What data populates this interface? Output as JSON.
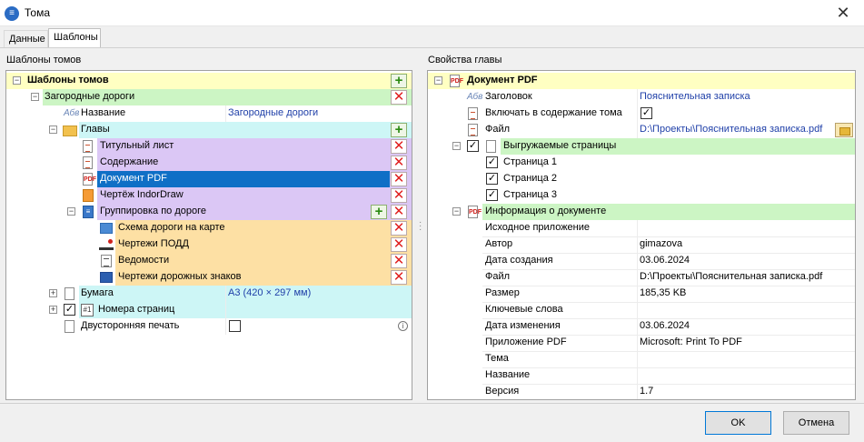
{
  "window": {
    "title": "Тома",
    "close_glyph": "✕"
  },
  "tabs": [
    {
      "label": "Данные",
      "active": false
    },
    {
      "label": "Шаблоны",
      "active": true
    }
  ],
  "left": {
    "section_label": "Шаблоны томов",
    "header": "Шаблоны томов",
    "volume": "Загородные дороги",
    "name_label": "Название",
    "name_value": "Загородные дороги",
    "chapters_label": "Главы",
    "chapters": [
      "Титульный лист",
      "Содержание",
      "Документ PDF",
      "Чертёж IndorDraw",
      "Группировка по дороге"
    ],
    "group_items": [
      "Схема дороги на карте",
      "Чертежи ПОДД",
      "Ведомости",
      "Чертежи дорожных знаков"
    ],
    "paper_label": "Бумага",
    "paper_value": "А3 (420 × 297 мм)",
    "page_numbers_label": "Номера страниц",
    "duplex_label": "Двусторонняя печать"
  },
  "right": {
    "section_label": "Свойства главы",
    "header": "Документ PDF",
    "heading_label": "Заголовок",
    "heading_value": "Пояснительная записка",
    "include_label": "Включать в содержание тома",
    "file_label": "Файл",
    "file_value": "D:\\Проекты\\Пояснительная записка.pdf",
    "pages_label": "Выгружаемые страницы",
    "pages": [
      "Страница 1",
      "Страница 2",
      "Страница 3"
    ],
    "docinfo_label": "Информация о документе",
    "info": [
      {
        "label": "Исходное приложение",
        "value": ""
      },
      {
        "label": "Автор",
        "value": "gimazova"
      },
      {
        "label": "Дата создания",
        "value": "03.06.2024"
      },
      {
        "label": "Файл",
        "value": "D:\\Проекты\\Пояснительная записка.pdf"
      },
      {
        "label": "Размер",
        "value": "185,35 KB"
      },
      {
        "label": "Ключевые слова",
        "value": ""
      },
      {
        "label": "Дата изменения",
        "value": "03.06.2024"
      },
      {
        "label": "Приложение PDF",
        "value": "Microsoft: Print To PDF"
      },
      {
        "label": "Тема",
        "value": ""
      },
      {
        "label": "Название",
        "value": ""
      },
      {
        "label": "Версия",
        "value": "1.7"
      }
    ]
  },
  "buttons": {
    "ok": "OK",
    "cancel": "Отмена"
  },
  "icons": {
    "abv_glyph": "Абв",
    "add_glyph": "+",
    "delete_glyph": "✕",
    "check_glyph": "✓",
    "expand_glyph": "+",
    "collapse_glyph": "−",
    "info_glyph": "i",
    "pdf_glyph": "PDF",
    "numbers_glyph": "#1"
  },
  "colors": {
    "yellow": "#ffffc2",
    "green": "#ccf5c4",
    "cyan": "#cdf6f6",
    "purple": "#dbc7f5",
    "orange": "#fde0a4",
    "selected": "#0f6fc6"
  }
}
